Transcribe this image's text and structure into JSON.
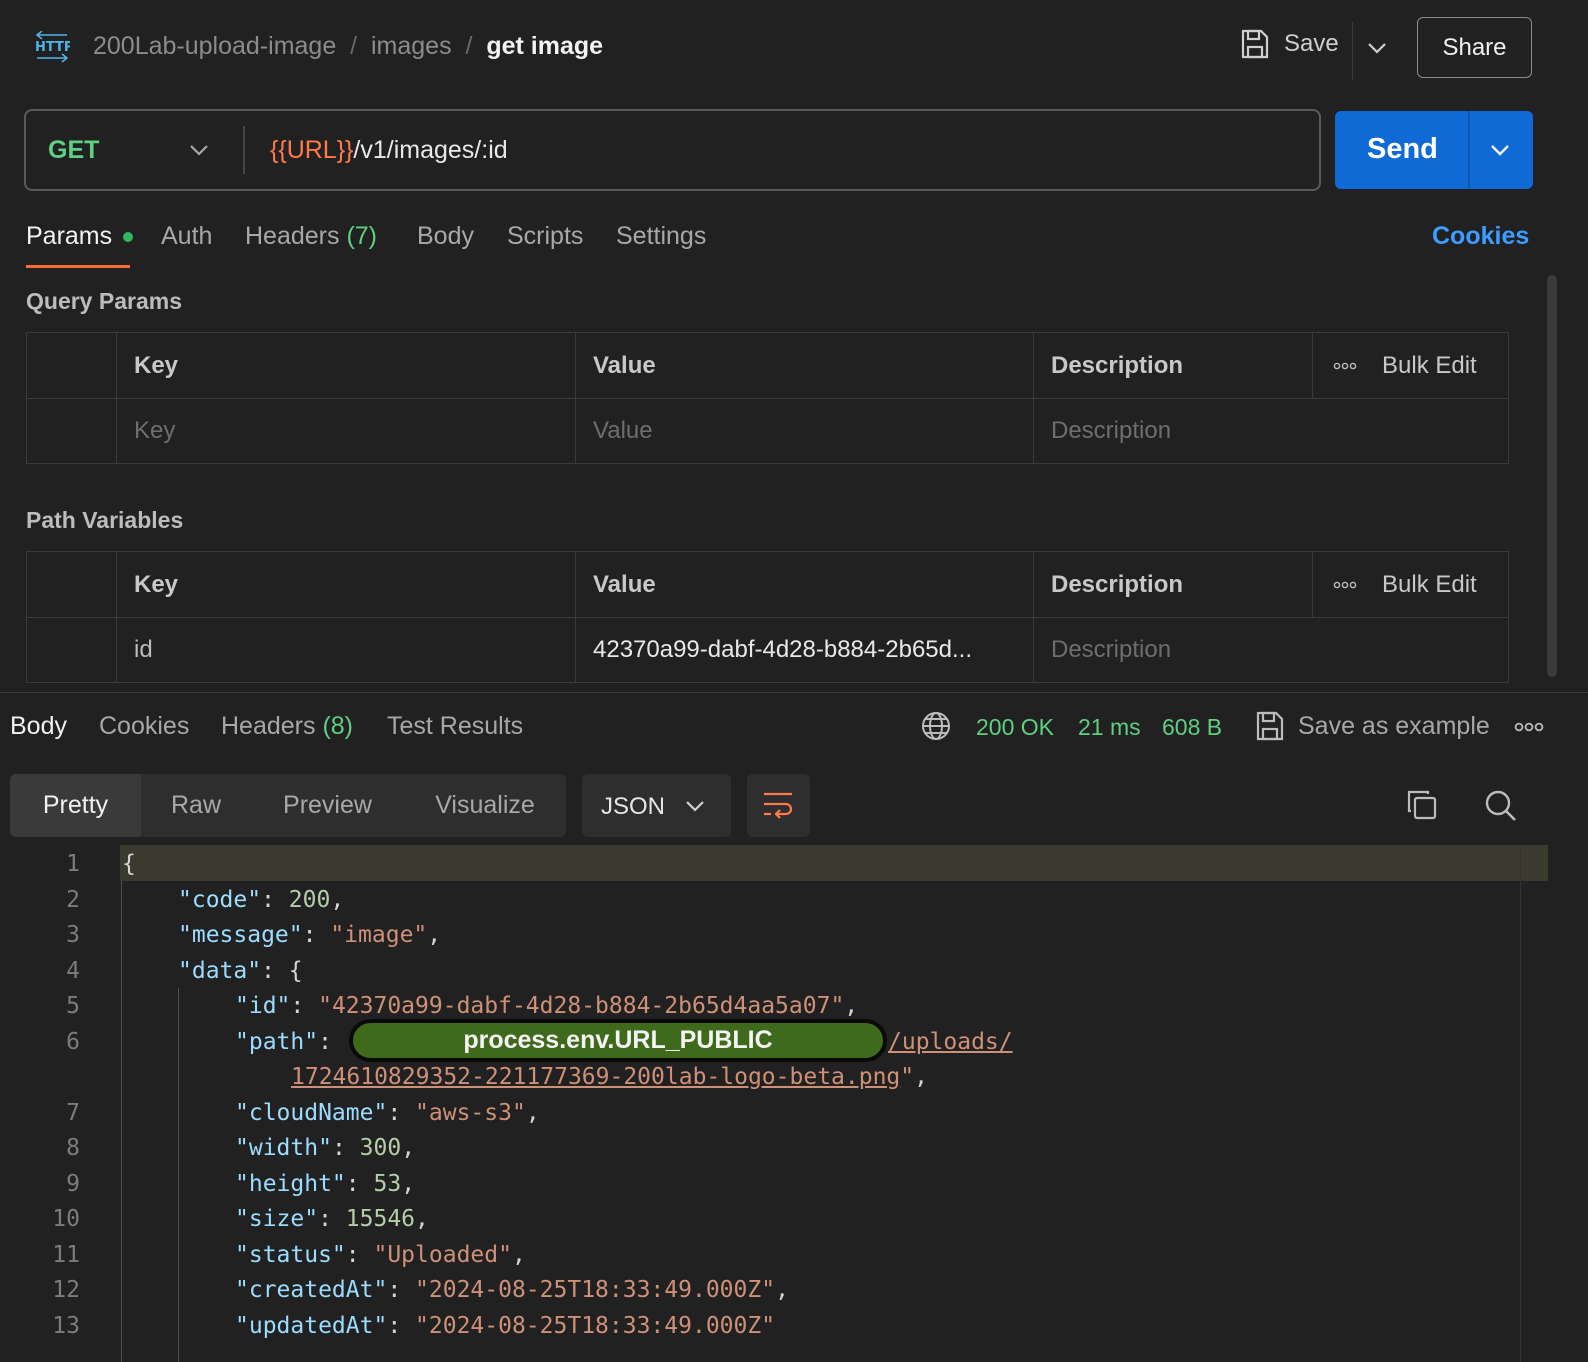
{
  "header": {
    "protocol_badge": "HTTP",
    "breadcrumb": [
      "200Lab-upload-image",
      "images",
      "get image"
    ],
    "save_label": "Save",
    "share_label": "Share"
  },
  "request": {
    "method": "GET",
    "url_variable": "{{URL}}",
    "url_path": "/v1/images/:id",
    "send_label": "Send"
  },
  "request_tabs": [
    {
      "label": "Params"
    },
    {
      "label": "Auth"
    },
    {
      "label": "Headers",
      "count": "(7)"
    },
    {
      "label": "Body"
    },
    {
      "label": "Scripts"
    },
    {
      "label": "Settings"
    }
  ],
  "cookies_label": "Cookies",
  "query_params": {
    "title": "Query Params",
    "columns": [
      "Key",
      "Value",
      "Description"
    ],
    "bulk_edit": "Bulk Edit",
    "row": {
      "key_placeholder": "Key",
      "value_placeholder": "Value",
      "description_placeholder": "Description"
    }
  },
  "path_variables": {
    "title": "Path Variables",
    "columns": [
      "Key",
      "Value",
      "Description"
    ],
    "bulk_edit": "Bulk Edit",
    "row": {
      "key": "id",
      "value": "42370a99-dabf-4d28-b884-2b65d...",
      "description_placeholder": "Description"
    }
  },
  "response": {
    "tabs": [
      {
        "label": "Body"
      },
      {
        "label": "Cookies"
      },
      {
        "label": "Headers",
        "count": "(8)"
      },
      {
        "label": "Test Results"
      }
    ],
    "status": "200 OK",
    "time": "21 ms",
    "size": "608 B",
    "save_example": "Save as example",
    "view_modes": [
      "Pretty",
      "Raw",
      "Preview",
      "Visualize"
    ],
    "format": "JSON"
  },
  "code": {
    "line_numbers": [
      "1",
      "2",
      "3",
      "4",
      "5",
      "6",
      "7",
      "8",
      "9",
      "10",
      "11",
      "12",
      "13"
    ],
    "brace_open": "{",
    "code_key": "\"code\"",
    "code_val": "200",
    "message_key": "\"message\"",
    "message_val": "\"image\"",
    "data_key": "\"data\"",
    "id_key": "\"id\"",
    "id_val": "\"42370a99-dabf-4d28-b884-2b65d4aa5a07\"",
    "path_key": "\"path\"",
    "path_redacted": "process.env.URL_PUBLIC",
    "path_link_1": "/uploads/",
    "path_link_2": "1724610829352-221177369-200lab-logo-beta.png",
    "path_end": "\"",
    "cloudName_key": "\"cloudName\"",
    "cloudName_val": "\"aws-s3\"",
    "width_key": "\"width\"",
    "width_val": "300",
    "height_key": "\"height\"",
    "height_val": "53",
    "size_key": "\"size\"",
    "size_val": "15546",
    "status_key": "\"status\"",
    "status_val": "\"Uploaded\"",
    "createdAt_key": "\"createdAt\"",
    "createdAt_val": "\"2024-08-25T18:33:49.000Z\"",
    "updatedAt_key": "\"updatedAt\"",
    "updatedAt_val": "\"2024-08-25T18:33:49.000Z\""
  },
  "colors": {
    "background": "#212121",
    "method_green": "#5fcf82",
    "send_blue": "#0f6ad6",
    "url_variable": "#ff7a4a",
    "active_tab_underline": "#ff6c37",
    "cookies_link": "#3d9cff"
  }
}
